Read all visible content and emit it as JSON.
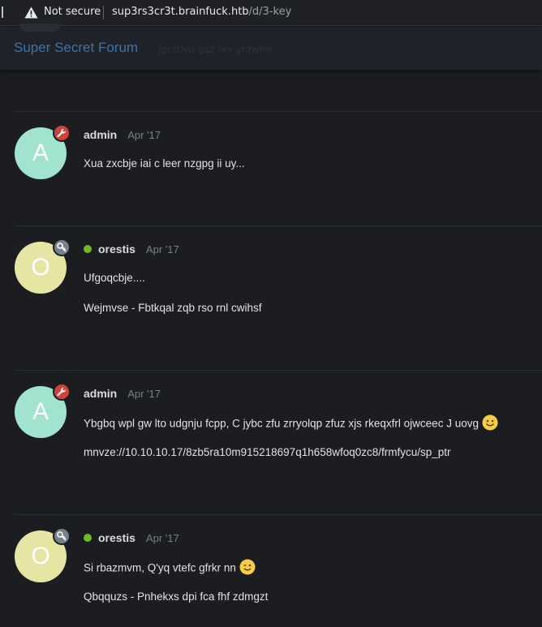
{
  "browser": {
    "security_label": "Not secure",
    "url_host": "sup3rs3cr3t.brainfuck.htb",
    "url_path": "/d/3-key"
  },
  "forum": {
    "title": "Super Secret Forum",
    "subtitle": "Jpcrbvu gsz rvv yhtwlm"
  },
  "posts": [
    {
      "avatar_letter": "A",
      "username": "admin",
      "date": "Apr '17",
      "badge": "wrench-icon",
      "online": false,
      "lines": [
        "Xua zxcbje iai c leer nzgpg ii uy..."
      ]
    },
    {
      "avatar_letter": "O",
      "username": "orestis",
      "date": "Apr '17",
      "badge": "key-icon",
      "online": true,
      "lines": [
        "Ufgoqcbje....",
        "Wejmvse - Fbtkqal zqb rso rnl cwihsf"
      ]
    },
    {
      "avatar_letter": "A",
      "username": "admin",
      "date": "Apr '17",
      "badge": "wrench-icon",
      "online": false,
      "lines": [
        "Ybgbq wpl gw lto udgnju fcpp, C jybc zfu zrryolqp zfuz xjs rkeqxfrl ojwceec J uovg",
        "mnvze://10.10.10.17/8zb5ra10m915218697q1h658wfoq0zc8/frmfycu/sp_ptr"
      ],
      "emoji": "smile-emoji"
    },
    {
      "avatar_letter": "O",
      "username": "orestis",
      "date": "Apr '17",
      "badge": "key-icon",
      "online": true,
      "lines": [
        "Si rbazmvm, Q'yq vtefc gfrkr nn",
        "Qbqquzs - Pnhekxs dpi fca fhf zdmgzt"
      ],
      "emoji": "wink-emoji"
    }
  ],
  "colors": {
    "background": "#1b1d21",
    "admin_badge": "#d1413c",
    "member_badge": "#77808f",
    "online": "#6fb923",
    "forum_title": "#3f72a6"
  }
}
